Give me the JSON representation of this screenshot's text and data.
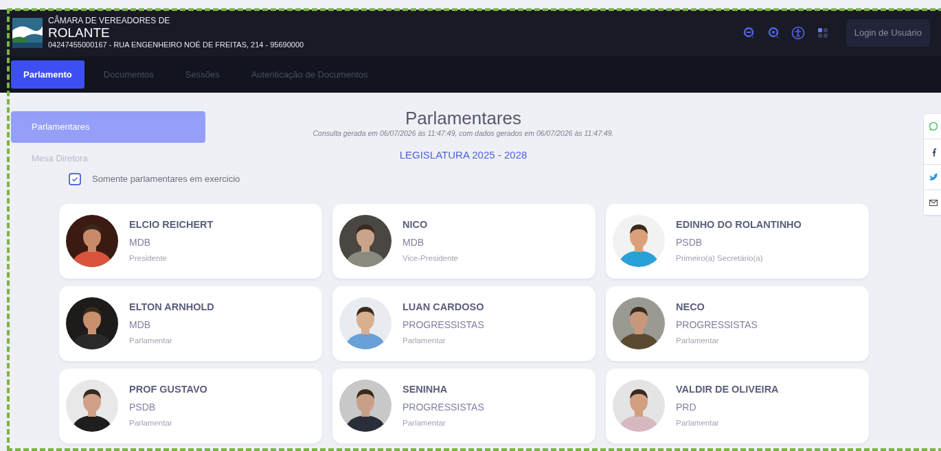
{
  "header": {
    "title_line": "CÂMARA DE VEREADORES DE",
    "title": "ROLANTE",
    "address": "04247455000167 - RUA ENGENHEIRO NOÉ DE FREITAS, 214 - 95690000",
    "login_button": "Login de Usuário"
  },
  "tabs": [
    {
      "label": "Parlamento",
      "selected": true
    },
    {
      "label": "Documentos",
      "selected": false
    },
    {
      "label": "Sessões",
      "selected": false
    },
    {
      "label": "Autenticação de Documentos",
      "selected": false
    }
  ],
  "sidebar": {
    "items": [
      {
        "label": "Parlamentares",
        "selected": true
      },
      {
        "label": "Mesa Diretora",
        "selected": false
      }
    ]
  },
  "page": {
    "title": "Parlamentares",
    "subtitle": "Consulta gerada em 06/07/2026 às 11:47:49, com dados gerados em 06/07/2026 às 11:47:49.",
    "legislature": "LEGISLATURA 2025 - 2028"
  },
  "filter": {
    "label": "Somente parlamentares em exercicio",
    "checked": true
  },
  "parliamentarians": [
    {
      "name": "ELCIO REICHERT",
      "party": "MDB",
      "role": "Presidente"
    },
    {
      "name": "NICO",
      "party": "MDB",
      "role": "Vice-Presidente"
    },
    {
      "name": "EDINHO DO ROLANTINHO",
      "party": "PSDB",
      "role": "Primeiro(a) Secretário(a)"
    },
    {
      "name": "ELTON ARNHOLD",
      "party": "MDB",
      "role": "Parlamentar"
    },
    {
      "name": "LUAN CARDOSO",
      "party": "PROGRESSISTAS",
      "role": "Parlamentar"
    },
    {
      "name": "NECO",
      "party": "PROGRESSISTAS",
      "role": "Parlamentar"
    },
    {
      "name": "PROF GUSTAVO",
      "party": "PSDB",
      "role": "Parlamentar"
    },
    {
      "name": "SENINHA",
      "party": "PROGRESSISTAS",
      "role": "Parlamentar"
    },
    {
      "name": "VALDIR DE OLIVEIRA",
      "party": "PRD",
      "role": "Parlamentar"
    }
  ]
}
